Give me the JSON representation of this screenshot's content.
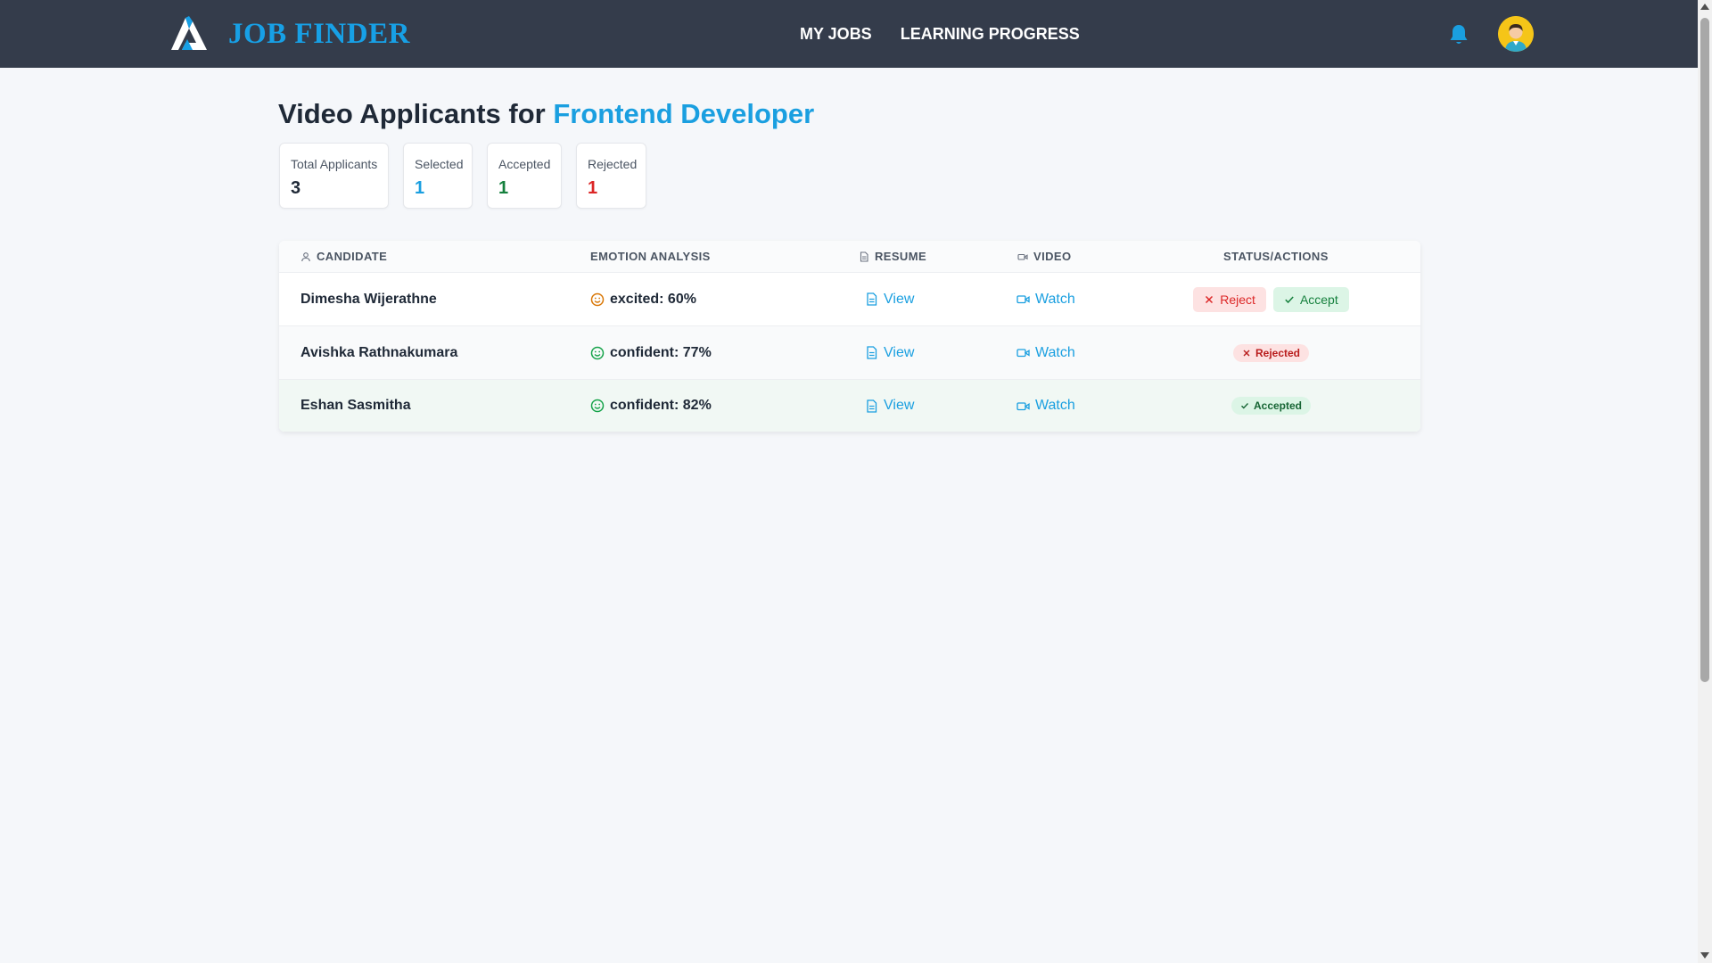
{
  "brand": {
    "name": "JOB FINDER",
    "logo_icon": "mountain-logo-icon"
  },
  "nav": {
    "links": [
      {
        "label": "MY JOBS"
      },
      {
        "label": "LEARNING PROGRESS"
      }
    ],
    "bell_icon": "bell-icon",
    "avatar_icon": "user-avatar-icon"
  },
  "page": {
    "title_prefix": "Video Applicants for",
    "job_title": "Frontend Developer"
  },
  "stats": {
    "total": {
      "label": "Total Applicants",
      "value": "3"
    },
    "selected": {
      "label": "Selected",
      "value": "1"
    },
    "accepted": {
      "label": "Accepted",
      "value": "1"
    },
    "rejected": {
      "label": "Rejected",
      "value": "1"
    }
  },
  "table": {
    "headers": {
      "candidate": "CANDIDATE",
      "emotion": "EMOTION ANALYSIS",
      "resume": "RESUME",
      "video": "VIDEO",
      "status": "STATUS/ACTIONS"
    },
    "rows": [
      {
        "name": "Dimesha Wijerathne",
        "emotion": "excited: 60%",
        "resume_label": "View",
        "video_label": "Watch",
        "status": "pending",
        "reject_label": "Reject",
        "accept_label": "Accept"
      },
      {
        "name": "Avishka Rathnakumara",
        "emotion": "confident: 77%",
        "resume_label": "View",
        "video_label": "Watch",
        "status": "rejected",
        "badge_label": "Rejected"
      },
      {
        "name": "Eshan Sasmitha",
        "emotion": "confident: 82%",
        "resume_label": "View",
        "video_label": "Watch",
        "status": "accepted",
        "badge_label": "Accepted"
      }
    ]
  },
  "colors": {
    "navbar": "#343c4b",
    "brand": "#17a0e6",
    "accent": "#1a9fe0",
    "accepted": "#15803d",
    "rejected": "#dc2626",
    "excited": "#d97706",
    "confident": "#16a34a"
  }
}
